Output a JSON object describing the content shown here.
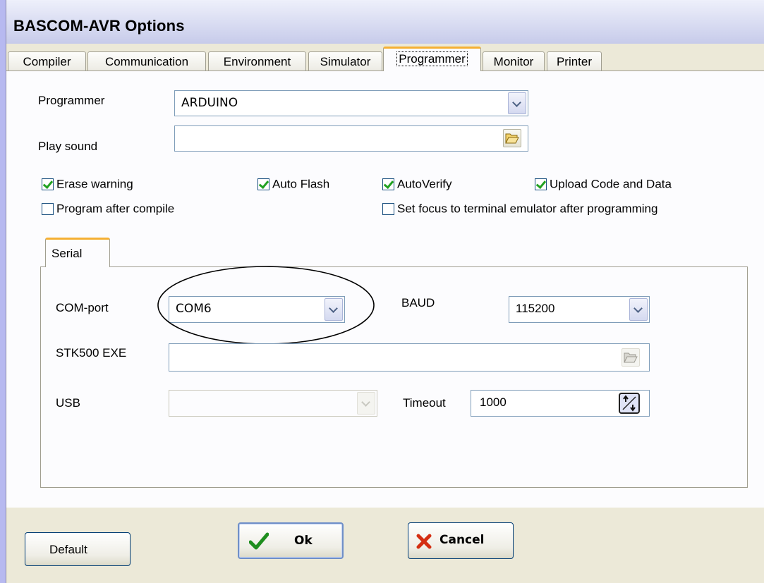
{
  "window": {
    "title": "BASCOM-AVR Options"
  },
  "tabs": [
    "Compiler",
    "Communication",
    "Environment",
    "Simulator",
    "Programmer",
    "Monitor",
    "Printer"
  ],
  "active_tab": "Programmer",
  "programmer": {
    "programmer_label": "Programmer",
    "programmer_value": "ARDUINO",
    "play_sound_label": "Play sound",
    "play_sound_value": ""
  },
  "options": {
    "erase_warning": {
      "label": "Erase warning",
      "checked": true
    },
    "auto_flash": {
      "label": "Auto Flash",
      "checked": true
    },
    "auto_verify": {
      "label": "AutoVerify",
      "checked": true
    },
    "upload_code": {
      "label": "Upload Code and Data",
      "checked": true
    },
    "program_after_compile": {
      "label": "Program after compile",
      "checked": false
    },
    "set_focus": {
      "label": "Set focus to terminal emulator after programming",
      "checked": false
    }
  },
  "serial": {
    "tab_label": "Serial",
    "com_port_label": "COM-port",
    "com_port_value": "COM6",
    "baud_label": "BAUD",
    "baud_value": "115200",
    "stk500_label": "STK500 EXE",
    "stk500_value": "",
    "usb_label": "USB",
    "usb_value": "",
    "timeout_label": "Timeout",
    "timeout_value": "1000"
  },
  "buttons": {
    "default": "Default",
    "ok": "Ok",
    "cancel": "Cancel"
  },
  "colors": {
    "check_green": "#21a121",
    "cancel_red": "#d42e12",
    "tab_accent": "#f5b033",
    "background": "#b7b9f0"
  }
}
